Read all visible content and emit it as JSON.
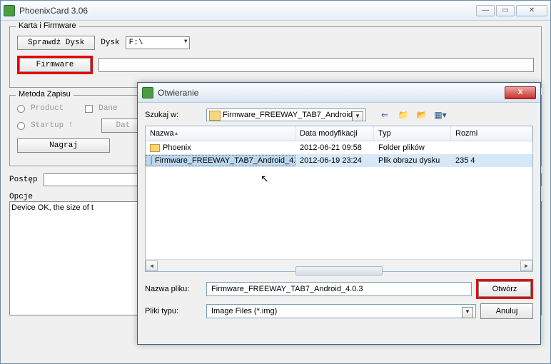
{
  "main": {
    "title": "PhoenixCard 3.06",
    "group_firmware": "Karta i Firmware",
    "btn_check_disk": "Sprawdź Dysk",
    "label_disk": "Dysk",
    "disk_value": "F:\\",
    "btn_firmware": "Firmware",
    "group_write": "Metoda Zapisu",
    "radio_product": "Product",
    "chk_dane": "Dane",
    "radio_startup": "Startup !",
    "btn_data": "Dat",
    "btn_burn": "Nagraj",
    "label_progress": "Postęp",
    "label_options": "Opcje",
    "log_text": "Device OK, the size of t"
  },
  "dialog": {
    "title": "Otwieranie",
    "lookin_label": "Szukaj w:",
    "lookin_value": "Firmware_FREEWAY_TAB7_Android",
    "col_name": "Nazwa",
    "col_date": "Data modyfikacji",
    "col_type": "Typ",
    "col_size": "Rozmi",
    "rows": [
      {
        "name": "Phoenix",
        "date": "2012-06-21 09:58",
        "type": "Folder plików",
        "size": ""
      },
      {
        "name": "Firmware_FREEWAY_TAB7_Android_4.0.3",
        "date": "2012-06-19 23:24",
        "type": "Plik obrazu dysku",
        "size": "235 4"
      }
    ],
    "filename_label": "Nazwa pliku:",
    "filename_value": "Firmware_FREEWAY_TAB7_Android_4.0.3",
    "filetype_label": "Pliki typu:",
    "filetype_value": "Image Files (*.img)",
    "btn_open": "Otwórz",
    "btn_cancel": "Anuluj"
  }
}
